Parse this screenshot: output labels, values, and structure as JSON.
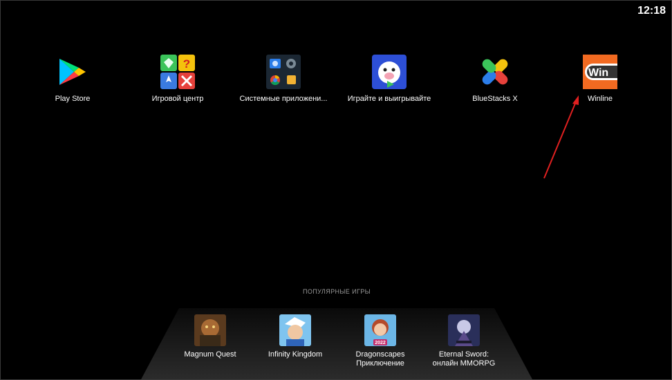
{
  "status_bar": {
    "time": "12:18"
  },
  "apps": [
    {
      "label": "Play Store",
      "icon": "play-store-icon"
    },
    {
      "label": "Игровой центр",
      "icon": "game-center-icon"
    },
    {
      "label": "Системные приложени...",
      "icon": "system-apps-folder-icon"
    },
    {
      "label": "Играйте и выигрывайте",
      "icon": "play-and-win-icon"
    },
    {
      "label": "BlueStacks X",
      "icon": "bluestacks-x-icon"
    },
    {
      "label": "Winline",
      "icon": "winline-icon",
      "icon_text": "Win"
    }
  ],
  "popular": {
    "title": "ПОПУЛЯРНЫЕ ИГРЫ",
    "games": [
      {
        "line1": "Magnum Quest",
        "line2": "",
        "icon": "magnum-quest-icon"
      },
      {
        "line1": "Infinity Kingdom",
        "line2": "",
        "icon": "infinity-kingdom-icon"
      },
      {
        "line1": "Dragonscapes",
        "line2": "Приключение",
        "icon": "dragonscapes-icon",
        "badge": "2022"
      },
      {
        "line1": "Eternal Sword:",
        "line2": "онлайн MMORPG",
        "icon": "eternal-sword-icon"
      }
    ]
  },
  "colors": {
    "background": "#000000",
    "annotation_arrow": "#e02020",
    "winline_orange": "#f26a21"
  }
}
